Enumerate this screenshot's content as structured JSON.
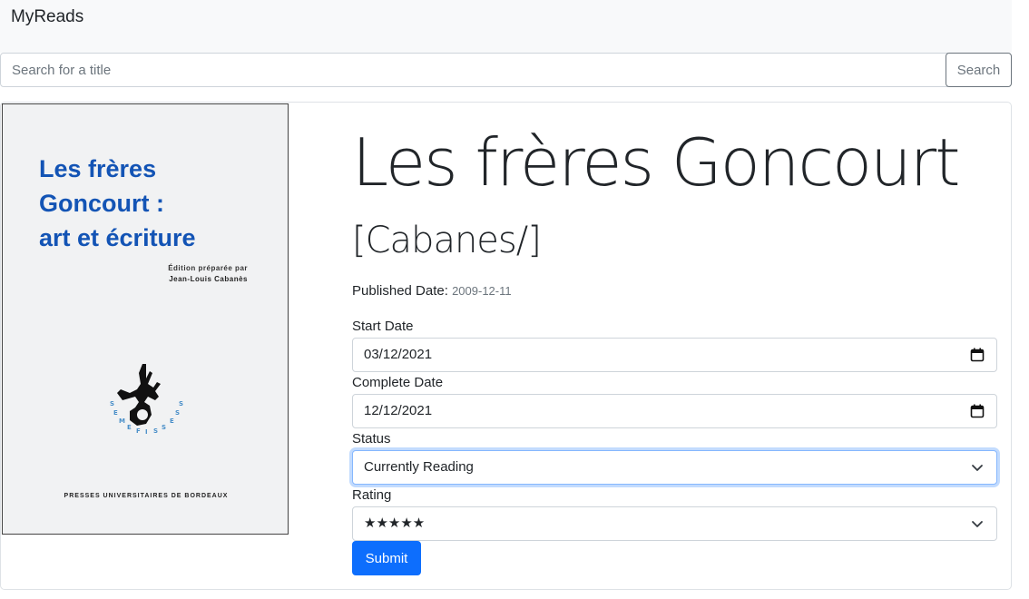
{
  "navbar": {
    "brand": "MyReads"
  },
  "search": {
    "placeholder": "Search for a title",
    "value": "",
    "button_label": "Search"
  },
  "book": {
    "title": "Les frères Goncourt",
    "author": "[Cabanes/]",
    "published_label": "Published Date:",
    "published_date": "2009-12-11",
    "cover": {
      "title_lines": [
        "Les frères",
        "Goncourt :",
        "art et écriture"
      ],
      "edition_line": "Édition préparée par",
      "editor": "Jean-Louis Cabanès",
      "series": "SEMEFISSE",
      "publisher": "PRESSES UNIVERSITAIRES DE BORDEAUX"
    }
  },
  "form": {
    "start_date_label": "Start Date",
    "start_date_value": "03/12/2021",
    "complete_date_label": "Complete Date",
    "complete_date_value": "12/12/2021",
    "status_label": "Status",
    "status_value": "Currently Reading",
    "rating_label": "Rating",
    "rating_value": "★★★★★",
    "submit_label": "Submit"
  },
  "icons": {
    "calendar": "calendar-icon",
    "chevron": "chevron-down-icon"
  },
  "colors": {
    "primary": "#0d6efd",
    "cover_title": "#1354b5",
    "secondary": "#6c757d"
  }
}
